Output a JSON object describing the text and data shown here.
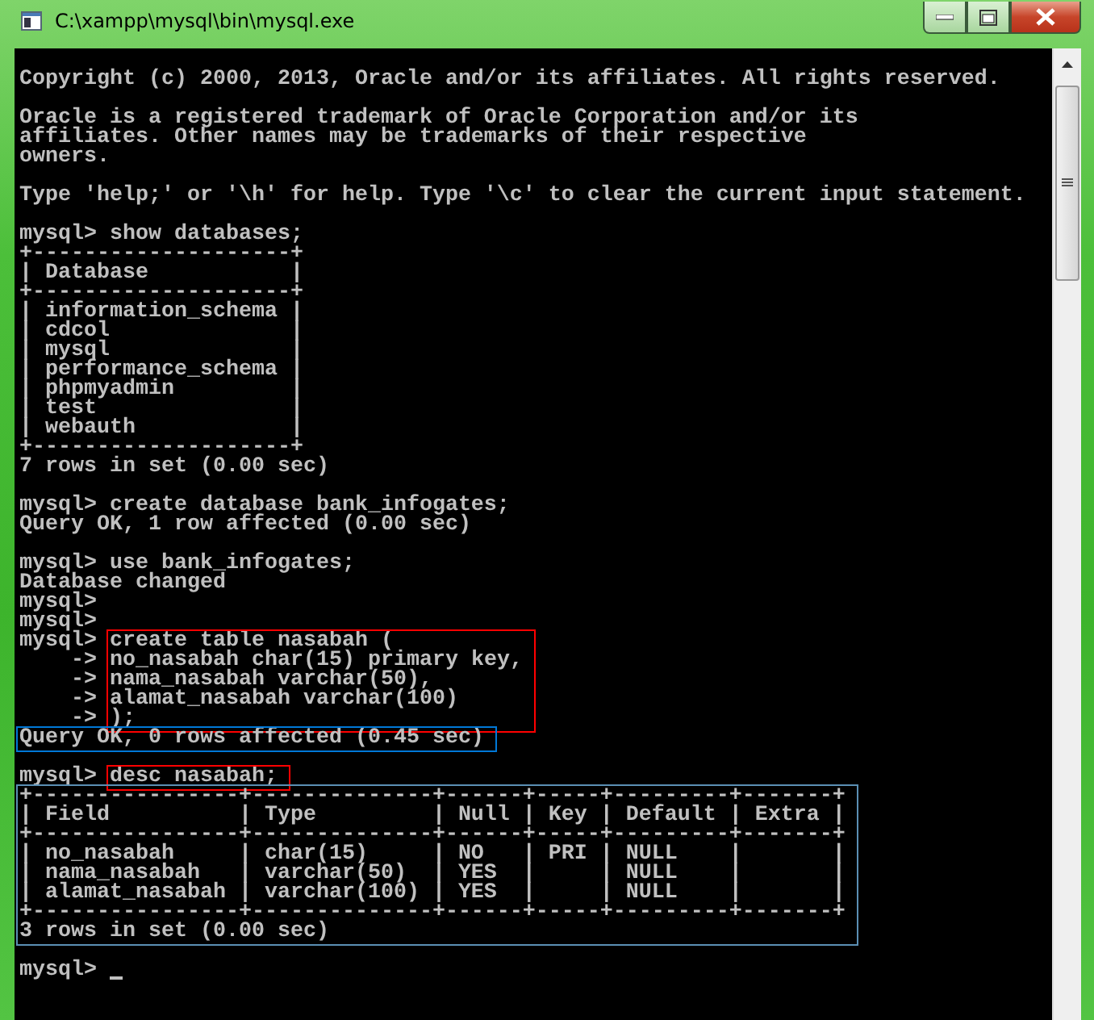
{
  "window": {
    "title": "C:\\xampp\\mysql\\bin\\mysql.exe",
    "controls": [
      {
        "kind": "minimize"
      },
      {
        "kind": "maximize"
      },
      {
        "kind": "close"
      }
    ]
  },
  "console": {
    "blocks": [
      {
        "gap_before": false,
        "lines": [
          "Copyright (c) 2000, 2013, Oracle and/or its affiliates. All rights reserved."
        ]
      },
      {
        "gap_before": true,
        "lines": [
          "Oracle is a registered trademark of Oracle Corporation and/or its",
          "affiliates. Other names may be trademarks of their respective",
          "owners."
        ]
      },
      {
        "gap_before": true,
        "lines": [
          "Type 'help;' or '\\h' for help. Type '\\c' to clear the current input statement."
        ]
      },
      {
        "gap_before": true,
        "lines": [
          "mysql> show databases;",
          "+--------------------+",
          "| Database           |",
          "+--------------------+",
          "| information_schema |",
          "| cdcol              |",
          "| mysql              |",
          "| performance_schema |",
          "| phpmyadmin         |",
          "| test               |",
          "| webauth            |",
          "+--------------------+",
          "7 rows in set (0.00 sec)"
        ]
      },
      {
        "gap_before": true,
        "lines": [
          "mysql> create database bank_infogates;",
          "Query OK, 1 row affected (0.00 sec)"
        ]
      },
      {
        "gap_before": true,
        "lines": [
          "mysql> use bank_infogates;",
          "Database changed",
          "mysql>",
          "mysql>"
        ]
      },
      {
        "gap_before": false,
        "color": "#ff0000",
        "prompts": [
          "mysql>",
          "    ->",
          "    ->",
          "    ->",
          "    ->"
        ],
        "lines": [
          "create table nasabah (",
          "no_nasabah char(15) primary key,",
          "nama_nasabah varchar(50),",
          "alamat_nasabah varchar(100)",
          ");"
        ]
      },
      {
        "gap_before": false,
        "color": "#0078d7",
        "lines": [
          "Query OK, 0 rows affected (0.45 sec)"
        ]
      },
      {
        "gap_before": true,
        "color": "#ff0000",
        "prompts": [
          "mysql>"
        ],
        "lines": [
          "desc nasabah;"
        ]
      },
      {
        "gap_before": false,
        "color": "#5a8fb4",
        "lines": [
          "+----------------+--------------+------+-----+---------+-------+",
          "| Field          | Type         | Null | Key | Default | Extra |",
          "+----------------+--------------+------+-----+---------+-------+",
          "| no_nasabah     | char(15)     | NO   | PRI | NULL    |       |",
          "| nama_nasabah   | varchar(50)  | YES  |     | NULL    |       |",
          "| alamat_nasabah | varchar(100) | YES  |     | NULL    |       |",
          "+----------------+--------------+------+-----+---------+-------+",
          "3 rows in set (0.00 sec)"
        ]
      },
      {
        "gap_before": true,
        "cursor": true,
        "lines": [
          "mysql>"
        ]
      }
    ]
  }
}
